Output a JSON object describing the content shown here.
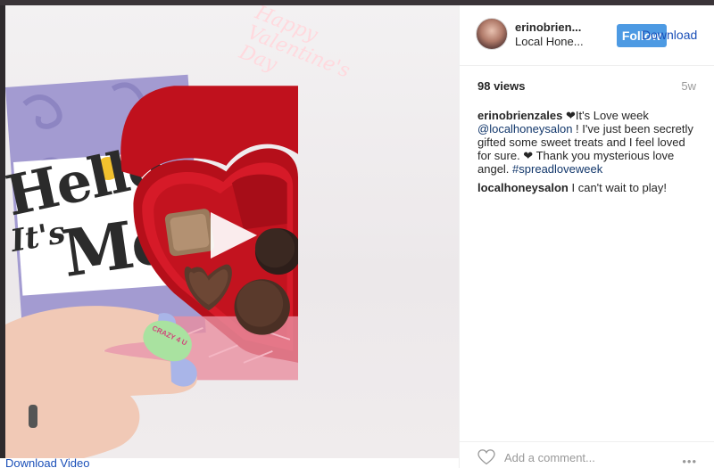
{
  "post": {
    "username": "erinobrien...",
    "location": "Local Hone...",
    "follow_label": "Follow",
    "download_label": "Download",
    "views": "98 views",
    "age": "5w",
    "caption": {
      "user": "erinobrienzales",
      "text_1": "❤It's Love week ",
      "mention": "@localhoneysalon",
      "text_2": " ! I've just been secretly gifted some sweet treats and I feel loved for sure. ❤ Thank you mysterious love angel. ",
      "hashtag": "#spreadloveweek"
    },
    "reply": {
      "user": "localhoneysalon",
      "text": " I can't wait to play!"
    },
    "add_comment_placeholder": "Add a comment...",
    "more_label": "•••"
  },
  "media": {
    "download_video_label": "Download Video",
    "box_text": "Happy Valentine's Day",
    "card_hello": "Hello",
    "card_its": "It's",
    "card_me": "Me",
    "candy_text": "CRAZY 4 U"
  },
  "colors": {
    "follow": "#4d9ae3",
    "link": "#1a4fb8",
    "box_red": "#c4121f"
  },
  "icons": {
    "heart": "heart-icon",
    "more": "more-icon",
    "play": "play-icon"
  }
}
